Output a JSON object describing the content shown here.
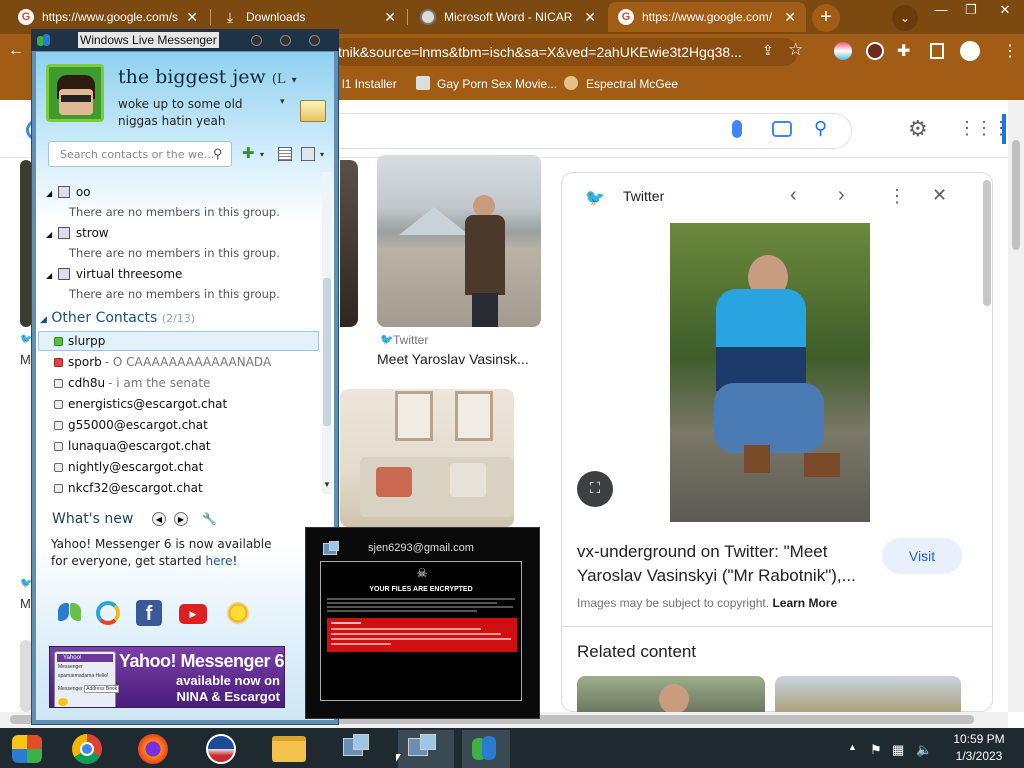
{
  "chrome": {
    "tabs": [
      {
        "title": "https://www.google.com/s",
        "icon": "google-icon"
      },
      {
        "title": "Downloads",
        "icon": "download-icon"
      },
      {
        "title": "Microsoft Word - NICAR",
        "icon": "word-icon"
      },
      {
        "title": "https://www.google.com/",
        "icon": "google-icon",
        "active": true
      }
    ],
    "new_tab_label": "+",
    "url": "tnik&source=lnms&tbm=isch&sa=X&ved=2ahUKEwie3t2Hgq38...",
    "bookmarks": [
      "l1 Installer",
      "Gay Porn Sex Movie...",
      "Espectral McGee"
    ],
    "theme_color": "#a15c15"
  },
  "google": {
    "results": [
      {
        "source": "Twitter",
        "title": "Meet Yaroslav Vasinsk..."
      }
    ],
    "panel": {
      "source": "Twitter",
      "title": "vx-underground on Twitter: \"Meet Yaroslav Vasinskyi (\"Mr Rabotnik\"),...",
      "visit_label": "Visit",
      "copyright": "Images may be subject to copyright.",
      "learn_more": "Learn More",
      "related_heading": "Related content"
    }
  },
  "messenger": {
    "window_title": "Windows Live Messenger",
    "display_name": "the biggest jew",
    "display_name_suffix": "(L",
    "personal_message": "woke up to some old niggas hatin yeah",
    "search_placeholder": "Search contacts or the we...",
    "groups": [
      {
        "name": "oo",
        "empty_text": "There are no members in this group."
      },
      {
        "name": "strow",
        "empty_text": "There are no members in this group."
      },
      {
        "name": "virtual threesome",
        "empty_text": "There are no members in this group."
      }
    ],
    "other_contacts": {
      "label": "Other Contacts",
      "count": "(2/13)"
    },
    "contacts": [
      {
        "name": "slurpp",
        "psm": "",
        "status": "online"
      },
      {
        "name": "sporb",
        "psm": "- O CAAAAAAAAAAAANADA",
        "status": "busy"
      },
      {
        "name": "cdh8u",
        "psm": "- i am the senate",
        "status": "offline"
      },
      {
        "name": "energistics@escargot.chat",
        "psm": "",
        "status": "offline"
      },
      {
        "name": "g55000@escargot.chat",
        "psm": "",
        "status": "offline"
      },
      {
        "name": "lunaqua@escargot.chat",
        "psm": "",
        "status": "offline"
      },
      {
        "name": "nightly@escargot.chat",
        "psm": "",
        "status": "offline"
      },
      {
        "name": "nkcf32@escargot.chat",
        "psm": "",
        "status": "offline"
      }
    ],
    "whats_new": {
      "heading": "What's new",
      "text": "Yahoo! Messenger 6 is now available for everyone, get started",
      "link": "here",
      "text_end": "!"
    },
    "ad": {
      "line1": "Yahoo! Messenger 6",
      "line2": "available now on",
      "line3": "NINA & Escargot",
      "mini_title": "Yahoo!",
      "mini_menu": "Messenger",
      "mini_user": "spamarmadama",
      "mini_hello": "Hello!",
      "mini_tab1": "Messenger",
      "mini_tab2": "Address Book"
    }
  },
  "popup": {
    "email": "sjen6293@gmail.com",
    "heading": "YOUR FILES ARE ENCRYPTED"
  },
  "taskbar": {
    "time": "10:59 PM",
    "date": "1/3/2023"
  }
}
